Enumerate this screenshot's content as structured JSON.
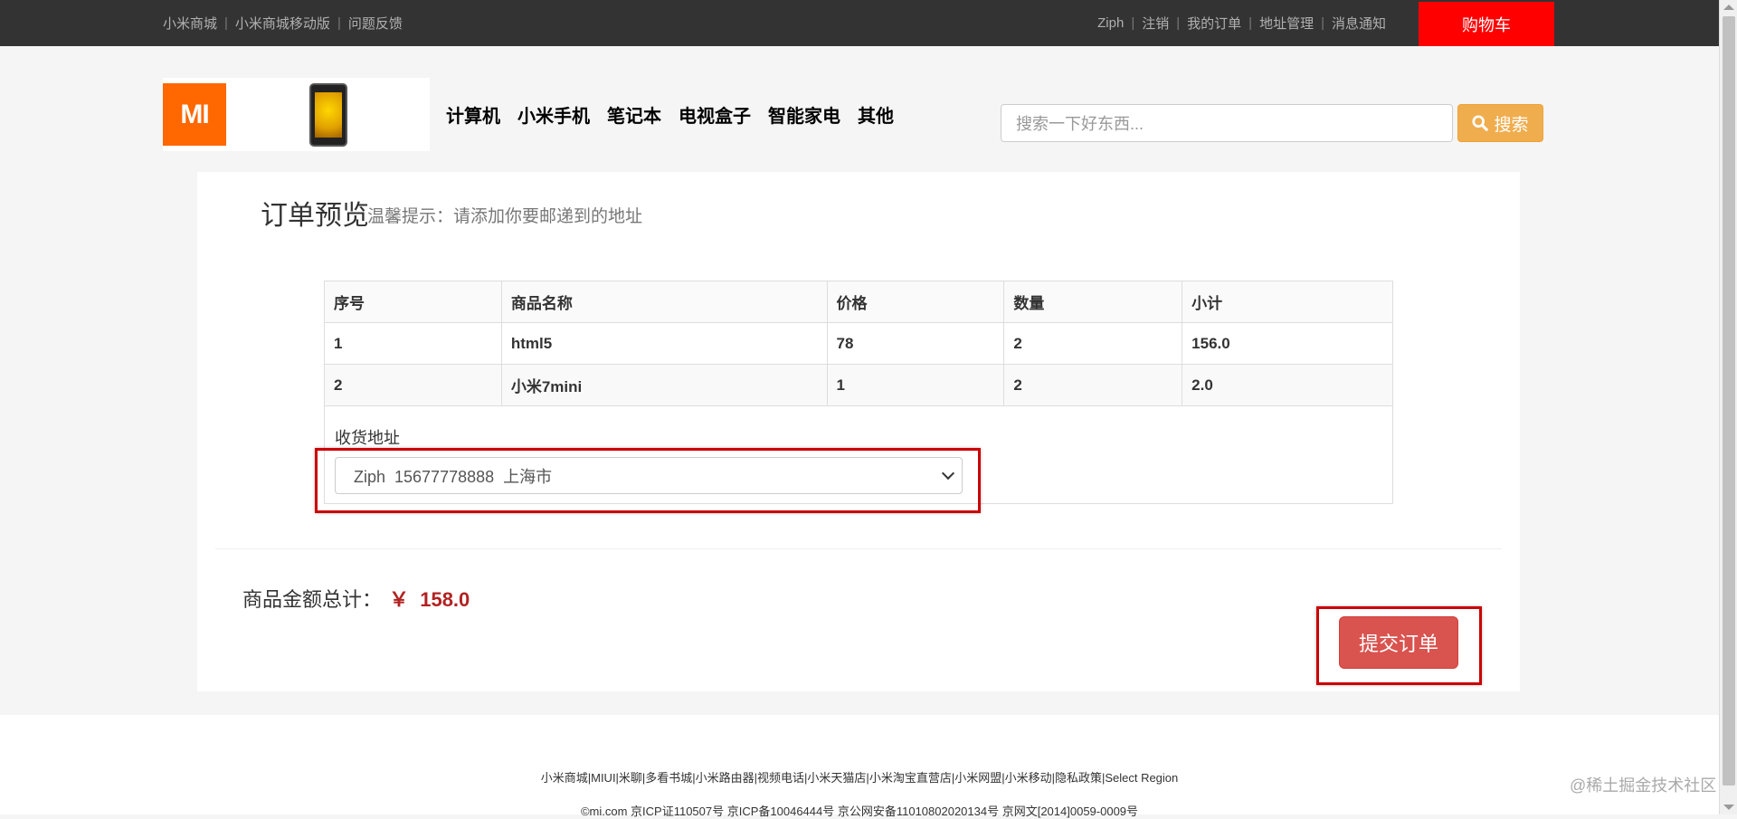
{
  "topbar": {
    "left_links": [
      "小米商城",
      "小米商城移动版",
      "问题反馈"
    ],
    "right_links": [
      "Ziph",
      "注销",
      "我的订单",
      "地址管理",
      "消息通知"
    ],
    "cart_label": "购物车"
  },
  "header": {
    "logo_text": "MI",
    "nav": [
      "计算机",
      "小米手机",
      "笔记本",
      "电视盒子",
      "智能家电",
      "其他"
    ],
    "search_placeholder": "搜索一下好东西...",
    "search_button": "搜索"
  },
  "order": {
    "title": "订单预览",
    "tip": "温馨提示：请添加你要邮递到的地址",
    "columns": [
      "序号",
      "商品名称",
      "价格",
      "数量",
      "小计"
    ],
    "rows": [
      [
        "1",
        "html5",
        "78",
        "2",
        "156.0"
      ],
      [
        "2",
        "小米7mini",
        "1",
        "2",
        "2.0"
      ]
    ],
    "address_label": "收货地址",
    "address_selected": "Ziph  15677778888  上海市",
    "total_label": "商品金额总计：",
    "total_amount": "￥  158.0",
    "submit_label": "提交订单"
  },
  "footer": {
    "links": "小米商城|MIUI|米聊|多看书城|小米路由器|视频电话|小米天猫店|小米淘宝直营店|小米网盟|小米移动|隐私政策|Select Region",
    "copyright": "©mi.com 京ICP证110507号 京ICP备10046444号 京公网安备11010802020134号 京网文[2014]0059-0009号"
  },
  "watermark": "@稀土掘金技术社区",
  "colors": {
    "topbar": "#333333",
    "cart": "#ff0000",
    "logo": "#ff6700",
    "search_button": "#f0ad4e",
    "submit": "#d9534f",
    "highlight": "#cc0000"
  }
}
